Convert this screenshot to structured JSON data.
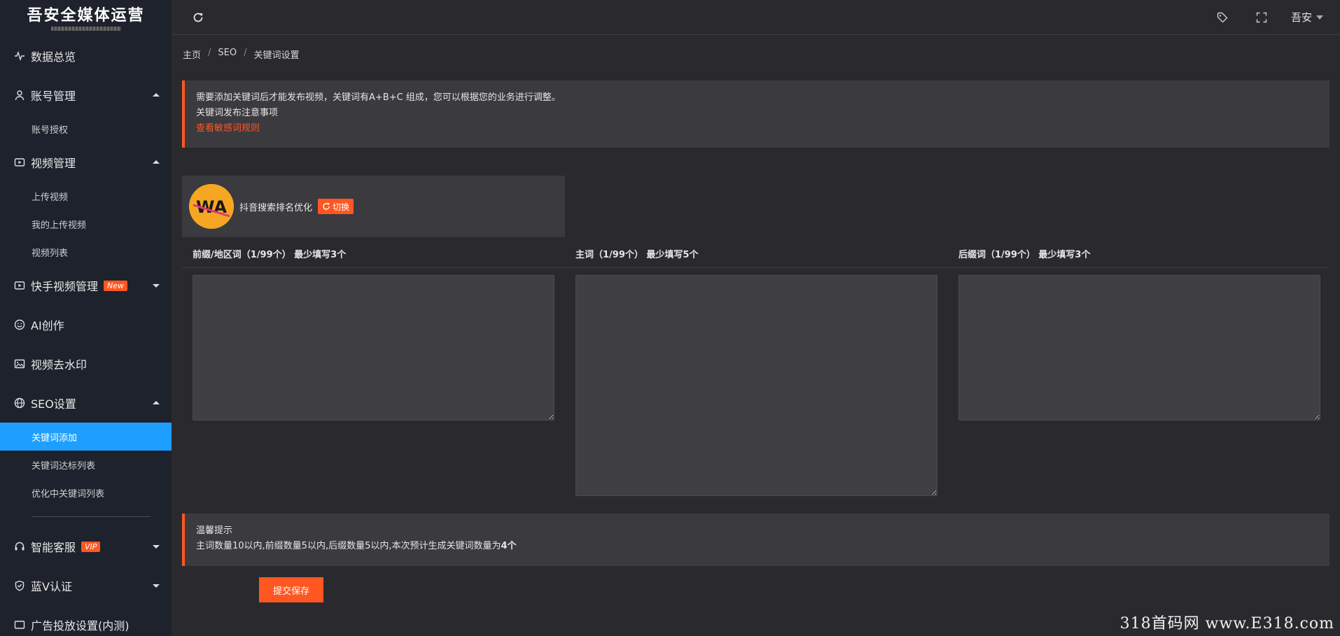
{
  "app": {
    "title": "吾安全媒体运营"
  },
  "sidebar": {
    "items": [
      {
        "label": "数据总览",
        "icon": "pulse-icon"
      },
      {
        "label": "账号管理",
        "icon": "user-icon",
        "expanded": true,
        "children": [
          "账号授权"
        ]
      },
      {
        "label": "视频管理",
        "icon": "video-icon",
        "expanded": true,
        "children": [
          "上传视频",
          "我的上传视频",
          "视频列表"
        ]
      },
      {
        "label": "快手视频管理",
        "icon": "video-icon",
        "badge": "New",
        "expanded": false
      },
      {
        "label": "AI创作",
        "icon": "smile-icon"
      },
      {
        "label": "视频去水印",
        "icon": "image-icon"
      },
      {
        "label": "SEO设置",
        "icon": "globe-icon",
        "expanded": true,
        "children": [
          "关键词添加",
          "关键词达标列表",
          "优化中关键词列表"
        ],
        "active_child": "关键词添加"
      },
      {
        "label": "智能客服",
        "icon": "headset-icon",
        "badge": "VIP",
        "expanded": false
      },
      {
        "label": "蓝V认证",
        "icon": "shield-icon",
        "expanded": false
      },
      {
        "label": "广告投放设置(内测)",
        "icon": "ad-icon"
      }
    ]
  },
  "header": {
    "user": "吾安",
    "icons": [
      "refresh-icon",
      "tag-icon",
      "fullscreen-icon"
    ]
  },
  "breadcrumb": [
    "主页",
    "SEO",
    "关键词设置"
  ],
  "notice": {
    "line1": "需要添加关键词后才能发布视频，关键词有A+B+C 组成，您可以根据您的业务进行调整。",
    "line2": "关键词发布注意事项",
    "link": "查看敏感词规则"
  },
  "account": {
    "name": "抖音搜索排名优化",
    "switch_label": "切换",
    "avatar_text": "WA"
  },
  "columns": {
    "prefix": "前缀/地区词（1/99个） 最少填写3个",
    "main": "主词（1/99个） 最少填写5个",
    "suffix": "后缀词（1/99个） 最少填写3个"
  },
  "tip": {
    "title": "温馨提示",
    "text": "主词数量10以内,前缀数量5以内,后缀数量5以内,本次预计生成关键词数量为",
    "count": "4个"
  },
  "submit_label": "提交保存",
  "watermark": "318首码网 www.E318.com",
  "colors": {
    "accent": "#ff5722",
    "active": "#1e9fff",
    "sidebar_bg": "#1e222d"
  }
}
